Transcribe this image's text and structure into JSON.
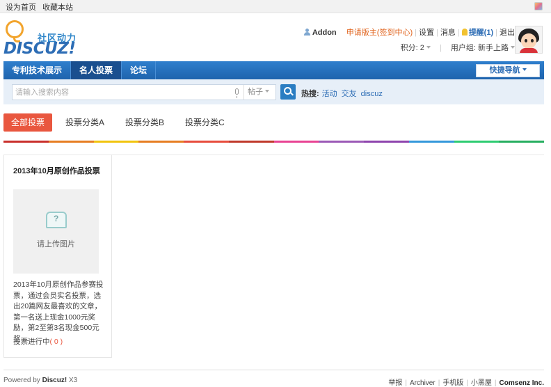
{
  "topbar": {
    "set_home": "设为首页",
    "bookmark": "收藏本站"
  },
  "logo": {
    "cn": "社区动力",
    "en": "DISCUZ!"
  },
  "user": {
    "name": "Addon",
    "apply": "申请版主(签到中心)",
    "settings": "设置",
    "messages": "消息",
    "remind": "提醒(1)",
    "logout": "退出",
    "points": "积分: 2",
    "group": "用户组: 新手上路"
  },
  "nav": {
    "items": [
      "专利技术展示",
      "名人投票",
      "论坛"
    ],
    "quick": "快捷导航"
  },
  "search": {
    "placeholder": "请输入搜索内容",
    "scope": "帖子",
    "hot_label": "热搜:",
    "hot_links": [
      "活动",
      "交友",
      "discuz"
    ]
  },
  "tabs": [
    "全部投票",
    "投票分类A",
    "投票分类B",
    "投票分类C"
  ],
  "colors": [
    "#c9302c",
    "#e67e22",
    "#f1c40f",
    "#e67e22",
    "#e74c3c",
    "#c0392b",
    "#e84393",
    "#9b59b6",
    "#8e44ad",
    "#3498db",
    "#2ecc71",
    "#27ae60"
  ],
  "card": {
    "title": "2013年10月原创作品投票",
    "placeholder_text": "请上传图片",
    "description": "2013年10月原创作品参赛投票，通过会员实名投票，选出20篇网友最喜欢的文章，第一名送上现金1000元奖励，第2至第3名现金500元奖 ...",
    "status_label": "投票进行中",
    "count": "( 0 )"
  },
  "footer": {
    "powered": "Powered by",
    "product": "Discuz!",
    "version": "X3",
    "links": [
      "举报",
      "Archiver",
      "手机版",
      "小黑屋"
    ],
    "company": "Comsenz Inc."
  }
}
